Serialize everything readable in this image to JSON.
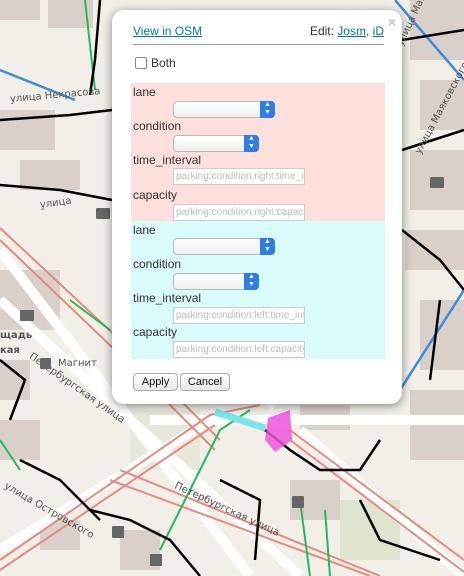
{
  "popup": {
    "view_link": "View in OSM",
    "edit_prefix": "Edit:",
    "edit_josm": "Josm",
    "edit_sep": ",",
    "edit_id": "iD",
    "close_glyph": "×",
    "both_label": "Both",
    "right": {
      "lane_label": "lane",
      "condition_label": "condition",
      "time_interval_label": "time_interval",
      "time_interval_placeholder": "parking:condition:right:time_interval",
      "capacity_label": "capacity",
      "capacity_placeholder": "parking:condition:right:capacity",
      "color": "#fde0db"
    },
    "left": {
      "lane_label": "lane",
      "condition_label": "condition",
      "time_interval_label": "time_interval",
      "time_interval_placeholder": "parking:condition:left:time_interval",
      "capacity_label": "capacity",
      "capacity_placeholder": "parking:condition:left:capacity",
      "color": "#d9fbfb"
    },
    "apply_label": "Apply",
    "cancel_label": "Cancel"
  },
  "map": {
    "labels": {
      "nekrasova": "улица Некрасова",
      "mayakovskogo_1": "улица Маяковского",
      "mayakovskogo_2": "улица Маяковского",
      "peterburgskaya_1": "Петербургская улица",
      "peterburgskaya_2": "Петербургская улица",
      "ostrovskogo": "улица Островского",
      "magnit": "Магнит",
      "ploshchad": "щадь",
      "skaya": "кая",
      "ulitsa": "улица"
    },
    "icons": [
      "book-icon",
      "book-icon",
      "bank-icon",
      "shop-icon",
      "church-icon",
      "church-icon",
      "church-icon"
    ]
  }
}
